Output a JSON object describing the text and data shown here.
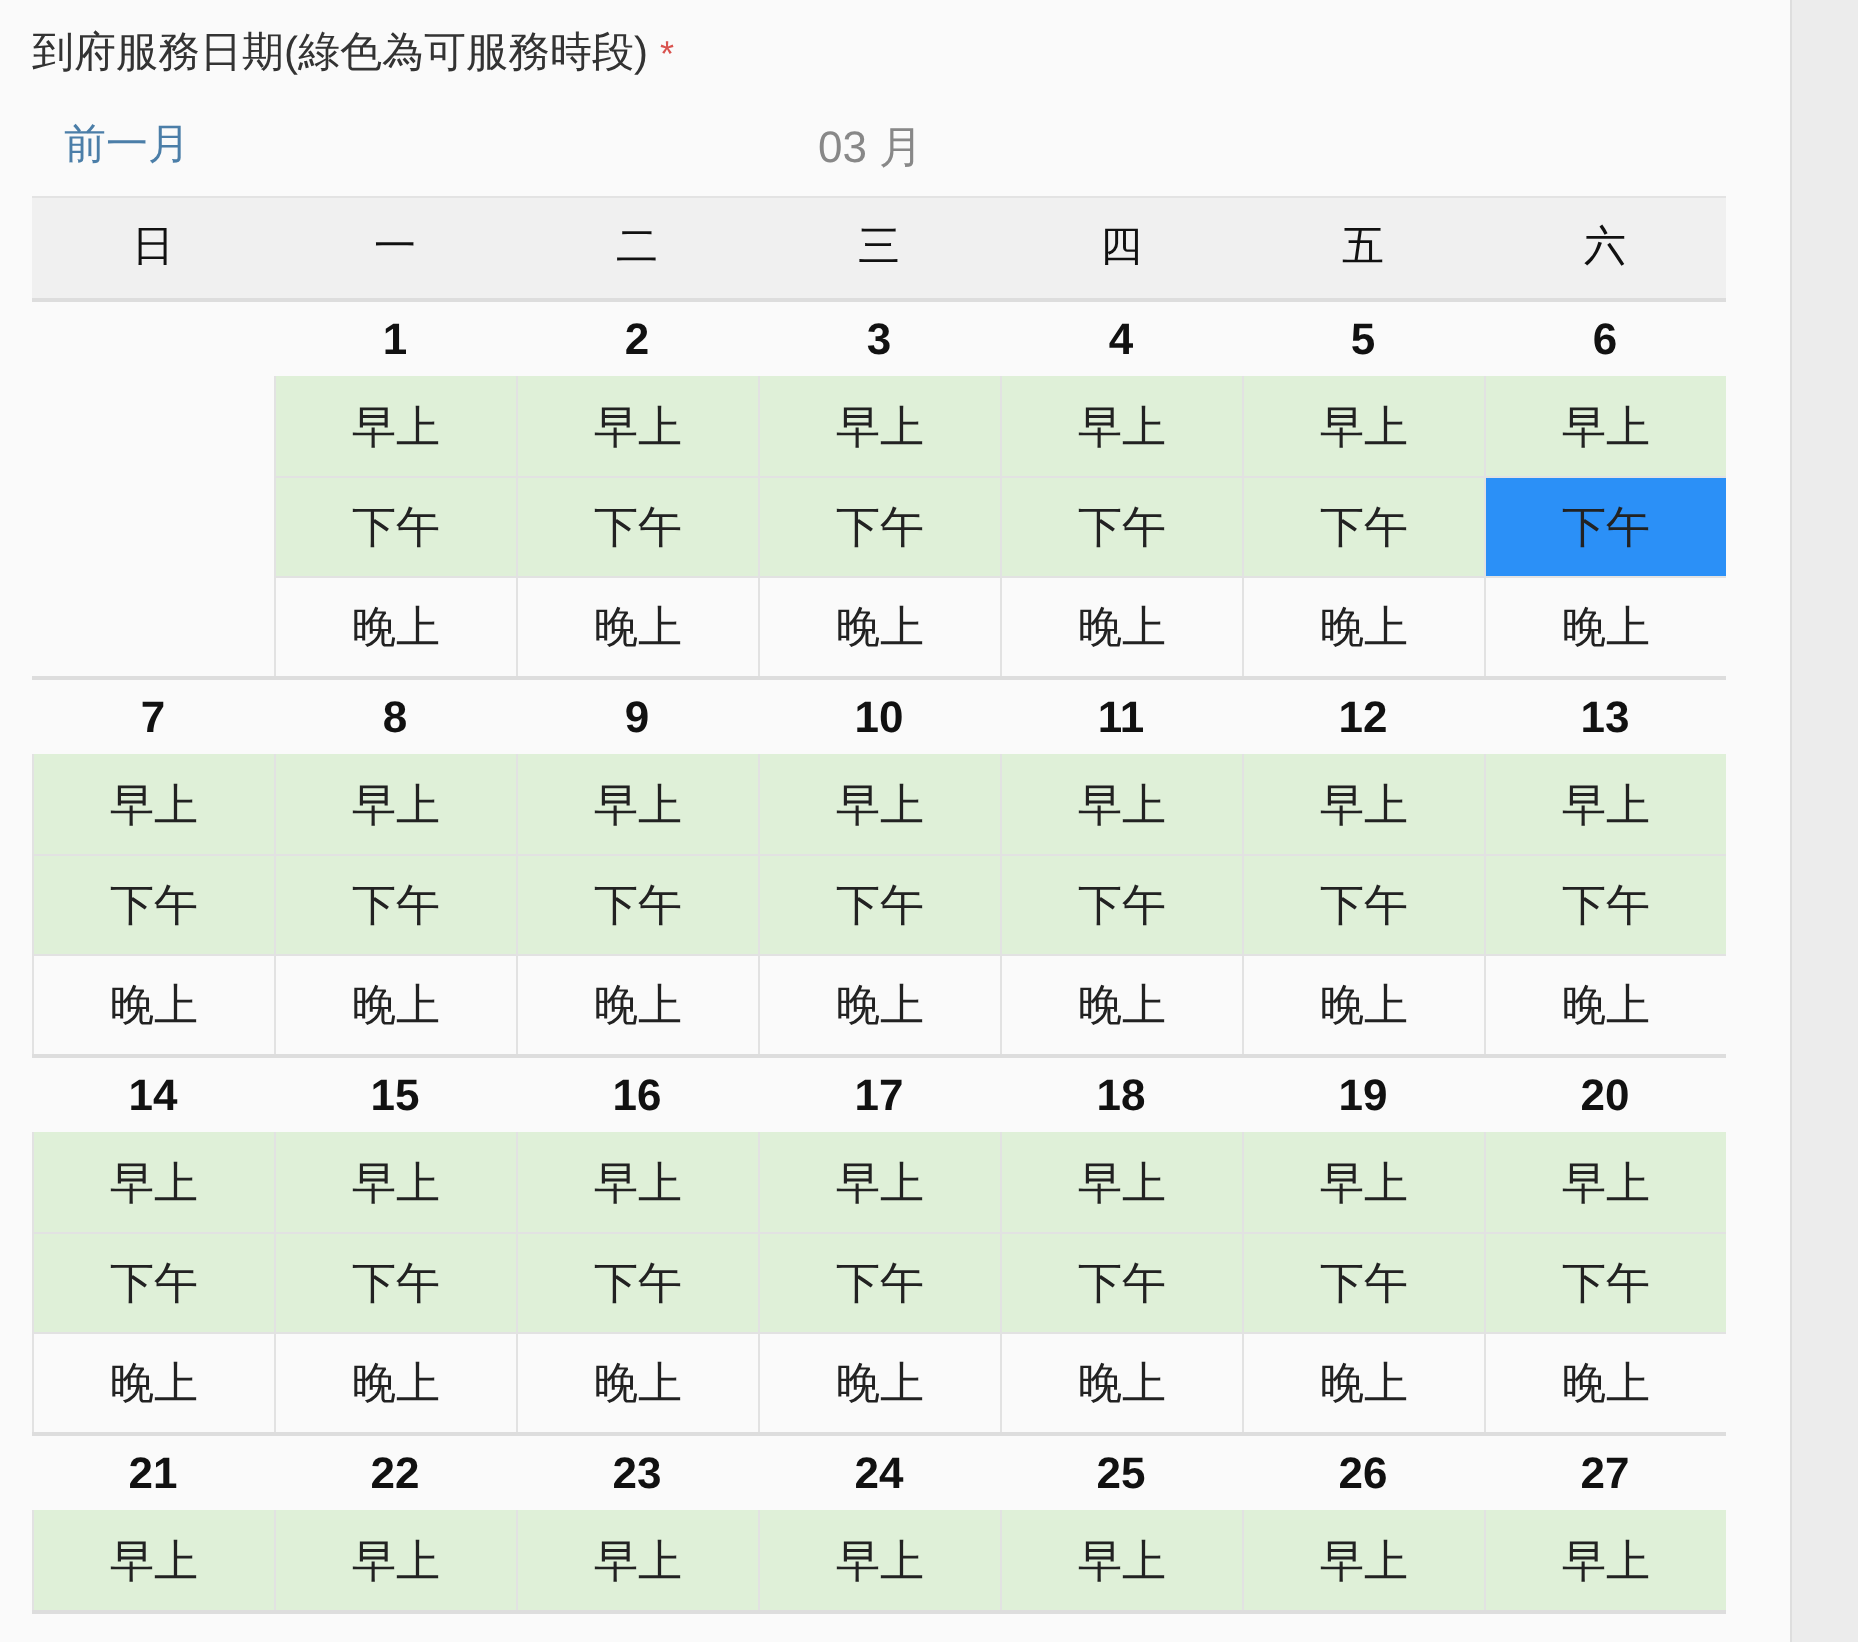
{
  "field_label": {
    "text": "到府服務日期(綠色為可服務時段)",
    "required_mark": "*"
  },
  "nav": {
    "prev": "前一月",
    "month": "03 月"
  },
  "weekdays": [
    "日",
    "一",
    "二",
    "三",
    "四",
    "五",
    "六"
  ],
  "weeks": [
    {
      "days": [
        {
          "kind": "blank"
        },
        {
          "kind": "day",
          "date": "1",
          "slots": [
            {
              "label": "早上",
              "available": true,
              "selected": false
            },
            {
              "label": "下午",
              "available": true,
              "selected": false
            },
            {
              "label": "晚上",
              "available": false,
              "selected": false
            }
          ]
        },
        {
          "kind": "day",
          "date": "2",
          "slots": [
            {
              "label": "早上",
              "available": true,
              "selected": false
            },
            {
              "label": "下午",
              "available": true,
              "selected": false
            },
            {
              "label": "晚上",
              "available": false,
              "selected": false
            }
          ]
        },
        {
          "kind": "day",
          "date": "3",
          "slots": [
            {
              "label": "早上",
              "available": true,
              "selected": false
            },
            {
              "label": "下午",
              "available": true,
              "selected": false
            },
            {
              "label": "晚上",
              "available": false,
              "selected": false
            }
          ]
        },
        {
          "kind": "day",
          "date": "4",
          "slots": [
            {
              "label": "早上",
              "available": true,
              "selected": false
            },
            {
              "label": "下午",
              "available": true,
              "selected": false
            },
            {
              "label": "晚上",
              "available": false,
              "selected": false
            }
          ]
        },
        {
          "kind": "day",
          "date": "5",
          "slots": [
            {
              "label": "早上",
              "available": true,
              "selected": false
            },
            {
              "label": "下午",
              "available": true,
              "selected": false
            },
            {
              "label": "晚上",
              "available": false,
              "selected": false
            }
          ]
        },
        {
          "kind": "day",
          "date": "6",
          "slots": [
            {
              "label": "早上",
              "available": true,
              "selected": false
            },
            {
              "label": "下午",
              "available": true,
              "selected": true
            },
            {
              "label": "晚上",
              "available": false,
              "selected": false
            }
          ]
        }
      ]
    },
    {
      "days": [
        {
          "kind": "day",
          "date": "7",
          "slots": [
            {
              "label": "早上",
              "available": true,
              "selected": false
            },
            {
              "label": "下午",
              "available": true,
              "selected": false
            },
            {
              "label": "晚上",
              "available": false,
              "selected": false
            }
          ]
        },
        {
          "kind": "day",
          "date": "8",
          "slots": [
            {
              "label": "早上",
              "available": true,
              "selected": false
            },
            {
              "label": "下午",
              "available": true,
              "selected": false
            },
            {
              "label": "晚上",
              "available": false,
              "selected": false
            }
          ]
        },
        {
          "kind": "day",
          "date": "9",
          "slots": [
            {
              "label": "早上",
              "available": true,
              "selected": false
            },
            {
              "label": "下午",
              "available": true,
              "selected": false
            },
            {
              "label": "晚上",
              "available": false,
              "selected": false
            }
          ]
        },
        {
          "kind": "day",
          "date": "10",
          "slots": [
            {
              "label": "早上",
              "available": true,
              "selected": false
            },
            {
              "label": "下午",
              "available": true,
              "selected": false
            },
            {
              "label": "晚上",
              "available": false,
              "selected": false
            }
          ]
        },
        {
          "kind": "day",
          "date": "11",
          "slots": [
            {
              "label": "早上",
              "available": true,
              "selected": false
            },
            {
              "label": "下午",
              "available": true,
              "selected": false
            },
            {
              "label": "晚上",
              "available": false,
              "selected": false
            }
          ]
        },
        {
          "kind": "day",
          "date": "12",
          "slots": [
            {
              "label": "早上",
              "available": true,
              "selected": false
            },
            {
              "label": "下午",
              "available": true,
              "selected": false
            },
            {
              "label": "晚上",
              "available": false,
              "selected": false
            }
          ]
        },
        {
          "kind": "day",
          "date": "13",
          "slots": [
            {
              "label": "早上",
              "available": true,
              "selected": false
            },
            {
              "label": "下午",
              "available": true,
              "selected": false
            },
            {
              "label": "晚上",
              "available": false,
              "selected": false
            }
          ]
        }
      ]
    },
    {
      "days": [
        {
          "kind": "day",
          "date": "14",
          "slots": [
            {
              "label": "早上",
              "available": true,
              "selected": false
            },
            {
              "label": "下午",
              "available": true,
              "selected": false
            },
            {
              "label": "晚上",
              "available": false,
              "selected": false
            }
          ]
        },
        {
          "kind": "day",
          "date": "15",
          "slots": [
            {
              "label": "早上",
              "available": true,
              "selected": false
            },
            {
              "label": "下午",
              "available": true,
              "selected": false
            },
            {
              "label": "晚上",
              "available": false,
              "selected": false
            }
          ]
        },
        {
          "kind": "day",
          "date": "16",
          "slots": [
            {
              "label": "早上",
              "available": true,
              "selected": false
            },
            {
              "label": "下午",
              "available": true,
              "selected": false
            },
            {
              "label": "晚上",
              "available": false,
              "selected": false
            }
          ]
        },
        {
          "kind": "day",
          "date": "17",
          "slots": [
            {
              "label": "早上",
              "available": true,
              "selected": false
            },
            {
              "label": "下午",
              "available": true,
              "selected": false
            },
            {
              "label": "晚上",
              "available": false,
              "selected": false
            }
          ]
        },
        {
          "kind": "day",
          "date": "18",
          "slots": [
            {
              "label": "早上",
              "available": true,
              "selected": false
            },
            {
              "label": "下午",
              "available": true,
              "selected": false
            },
            {
              "label": "晚上",
              "available": false,
              "selected": false
            }
          ]
        },
        {
          "kind": "day",
          "date": "19",
          "slots": [
            {
              "label": "早上",
              "available": true,
              "selected": false
            },
            {
              "label": "下午",
              "available": true,
              "selected": false
            },
            {
              "label": "晚上",
              "available": false,
              "selected": false
            }
          ]
        },
        {
          "kind": "day",
          "date": "20",
          "slots": [
            {
              "label": "早上",
              "available": true,
              "selected": false
            },
            {
              "label": "下午",
              "available": true,
              "selected": false
            },
            {
              "label": "晚上",
              "available": false,
              "selected": false
            }
          ]
        }
      ]
    },
    {
      "days": [
        {
          "kind": "day",
          "date": "21",
          "slots": [
            {
              "label": "早上",
              "available": true,
              "selected": false
            }
          ]
        },
        {
          "kind": "day",
          "date": "22",
          "slots": [
            {
              "label": "早上",
              "available": true,
              "selected": false
            }
          ]
        },
        {
          "kind": "day",
          "date": "23",
          "slots": [
            {
              "label": "早上",
              "available": true,
              "selected": false
            }
          ]
        },
        {
          "kind": "day",
          "date": "24",
          "slots": [
            {
              "label": "早上",
              "available": true,
              "selected": false
            }
          ]
        },
        {
          "kind": "day",
          "date": "25",
          "slots": [
            {
              "label": "早上",
              "available": true,
              "selected": false
            }
          ]
        },
        {
          "kind": "day",
          "date": "26",
          "slots": [
            {
              "label": "早上",
              "available": true,
              "selected": false
            }
          ]
        },
        {
          "kind": "day",
          "date": "27",
          "slots": [
            {
              "label": "早上",
              "available": true,
              "selected": false
            }
          ]
        }
      ]
    }
  ]
}
